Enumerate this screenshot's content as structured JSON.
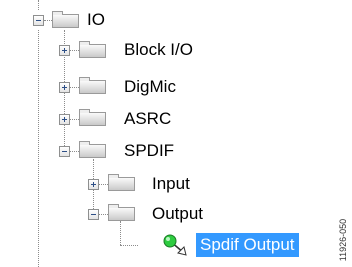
{
  "tree": {
    "root": {
      "label": "IO",
      "expanded": true
    },
    "items": [
      {
        "label": "Block I/O",
        "expanded": false
      },
      {
        "label": "DigMic",
        "expanded": false
      },
      {
        "label": "ASRC",
        "expanded": false
      },
      {
        "label": "SPDIF",
        "expanded": true,
        "children": [
          {
            "label": "Input",
            "expanded": false
          },
          {
            "label": "Output",
            "expanded": true,
            "children": [
              {
                "label": "Spdif Output",
                "selected": true
              }
            ]
          }
        ]
      }
    ]
  },
  "figure_id": "11926-050",
  "colors": {
    "selection": "#3399ff",
    "connector": "#8c8c8c"
  }
}
